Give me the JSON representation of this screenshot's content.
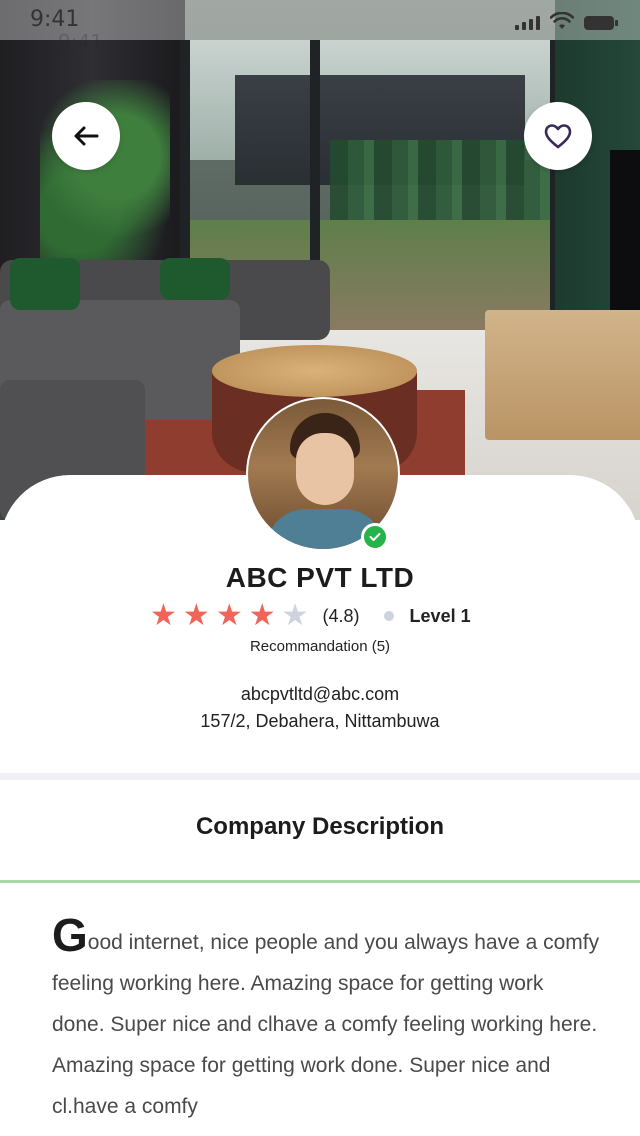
{
  "status_bar": {
    "time": "9:41",
    "time_ghost": "9:41"
  },
  "hero": {
    "back_icon": "arrow-left-icon",
    "favorite_icon": "heart-outline-icon"
  },
  "profile": {
    "company_name": "ABC PVT LTD",
    "rating_stars_filled": 4,
    "rating_stars_total": 5,
    "rating_value": "(4.8)",
    "level": "Level 1",
    "recommendation": "Recommandation (5)",
    "email": "abcpvtltd@abc.com",
    "address": "157/2, Debahera, Nittambuwa",
    "online": true
  },
  "description": {
    "title": "Company Description",
    "dropcap": "G",
    "text": "ood internet, nice people and you always have a comfy feeling working here. Amazing space for getting work done. Super nice and clhave a comfy feeling working here. Amazing space for getting work done. Super nice and cl.have a comfy"
  },
  "colors": {
    "star_filled": "#f0645a",
    "star_empty": "#cfd3e0",
    "online": "#27b34a",
    "accent_line": "#a7d9a7"
  }
}
